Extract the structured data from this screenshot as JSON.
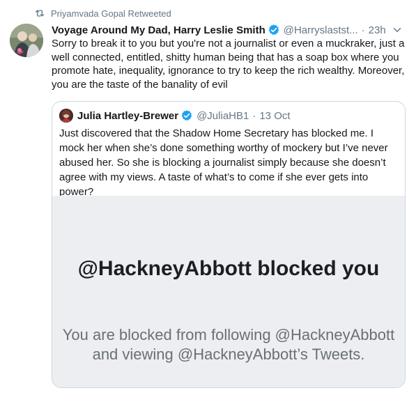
{
  "retweet": {
    "text": "Priyamvada Gopal Retweeted",
    "icon": "retweet-icon"
  },
  "tweet": {
    "display_name": "Voyage Around My Dad, Harry Leslie Smith",
    "handle": "@Harryslastst...",
    "separator": "·",
    "time": "23h",
    "text": "Sorry to break it to you but you're not a journalist or even a muckraker, just a well connected, entitled, shitty human being that has a soap box where you promote hate, inequality, ignorance to try to keep the rich wealthy. Moreover, you are the taste of the banality of evil"
  },
  "quote": {
    "display_name": "Julia Hartley-Brewer",
    "handle": "@JuliaHB1",
    "separator": "·",
    "date": "13 Oct",
    "text": "Just discovered that the Shadow Home Secretary has blocked me. I mock her when she’s done something worthy of mockery but I’ve never abused her. So she is blocking a journalist simply because she doesn’t agree with my views. A taste of what’s to come if she ever gets into power?",
    "image": {
      "title": "@HackneyAbbott blocked you",
      "subtitle": "You are blocked from following @HackneyAbbott and viewing @HackneyAbbott’s Tweets."
    }
  },
  "colors": {
    "accent": "#1da1f2",
    "secondary_text": "#657786",
    "border": "#ccd6dd",
    "image_bg": "#edeef1"
  }
}
